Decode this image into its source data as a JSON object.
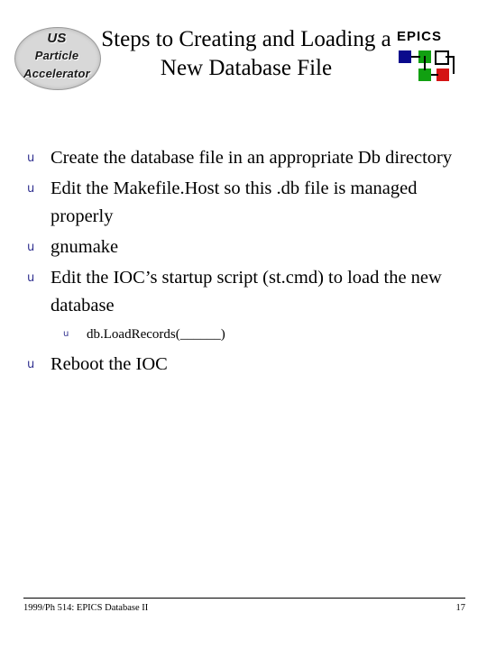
{
  "logo": {
    "line1": "US",
    "line2": "Particle",
    "line3": "Accelerator"
  },
  "title": "Steps to Creating and Loading a New Database File",
  "epics": {
    "word": "EPICS",
    "squares": [
      {
        "color": "#0a0a8c"
      },
      {
        "color": "#11a011"
      },
      {
        "color": "#ffffff"
      },
      {
        "color": "#11a011"
      },
      {
        "color": "#d41414"
      }
    ]
  },
  "bullets": [
    {
      "marker": "u",
      "text": "Create the database file in an appropriate Db directory"
    },
    {
      "marker": "u",
      "text": "Edit the Makefile.Host so this .db file is managed properly"
    },
    {
      "marker": "u",
      "text": "gnumake"
    },
    {
      "marker": "u",
      "text": "Edit the IOC’s startup script (st.cmd) to load the new database"
    }
  ],
  "sub_bullet": {
    "marker": "u",
    "text": "db.LoadRecords(______)"
  },
  "last_bullet": {
    "marker": "u",
    "text": "Reboot the IOC"
  },
  "footer": {
    "left": "1999/Ph 514: EPICS Database II",
    "page": "17"
  }
}
